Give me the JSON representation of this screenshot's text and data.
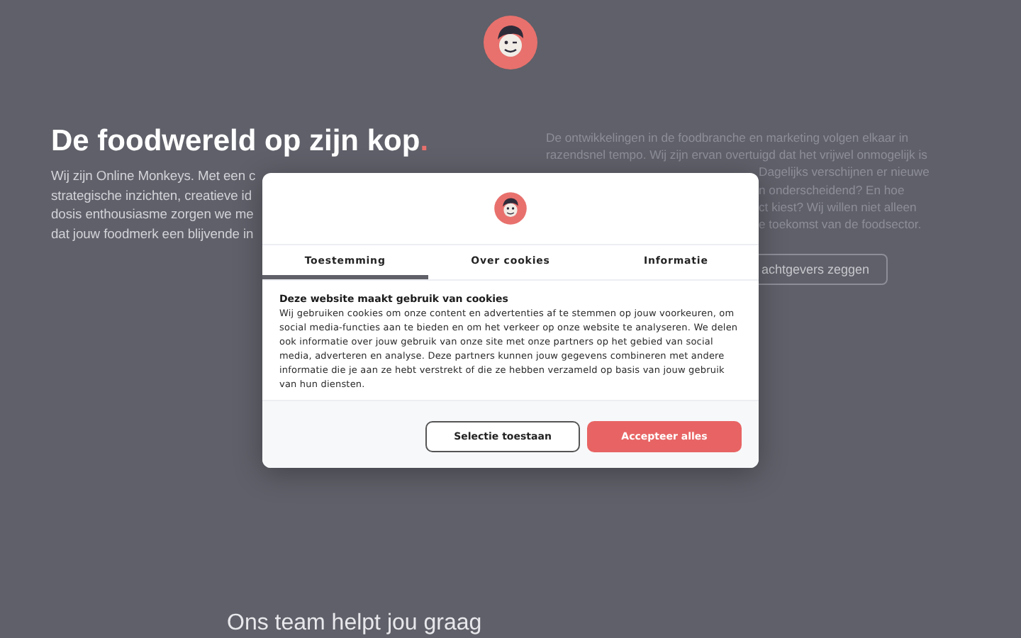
{
  "headline": {
    "text": "De foodwereld op zijn kop",
    "accent": "."
  },
  "intro_lines": [
    "Wij zijn Online Monkeys. Met een c",
    "strategische inzichten, creatieve id",
    "dosis enthousiasme zorgen we me",
    "dat jouw foodmerk een blijvende in"
  ],
  "side_lines": [
    {
      "kind": "full",
      "text": "De ontwikkelingen in de foodbranche en marketing volgen elkaar in"
    },
    {
      "kind": "full",
      "text": "razendsnel tempo. Wij zijn ervan overtuigd dat het vrijwel onmogelijk is"
    },
    {
      "kind": "tail",
      "text": "Dagelijks verschijnen er nieuwe"
    },
    {
      "kind": "tail",
      "text": "n onderscheidend? En hoe"
    },
    {
      "kind": "tail",
      "text": "ct kiest? Wij willen niet alleen"
    },
    {
      "kind": "tail",
      "text": "e toekomst van de foodsector."
    }
  ],
  "side_button": "achtgevers zeggen",
  "team_heading": "Ons team helpt jou graag",
  "cookie_dialog": {
    "tabs": [
      {
        "label": "Toestemming",
        "selected": true
      },
      {
        "label": "Over cookies",
        "selected": false
      },
      {
        "label": "Informatie",
        "selected": false
      }
    ],
    "title": "Deze website maakt gebruik van cookies",
    "body": "Wij gebruiken cookies om onze content en advertenties af te stemmen op jouw voorkeuren, om social media-functies aan te bieden en om het verkeer op onze website te analyseren. We delen ook informatie over jouw gebruik van onze site met onze partners op het gebied van social media, adverteren en analyse. Deze partners kunnen jouw gegevens combineren met andere informatie die je aan ze hebt verstrekt of die ze hebben verzameld op basis van jouw gebruik van hun diensten.",
    "buttons": [
      {
        "kind": "outline",
        "label": "Selectie toestaan"
      },
      {
        "kind": "primary",
        "label": "Accepteer alles"
      }
    ]
  }
}
